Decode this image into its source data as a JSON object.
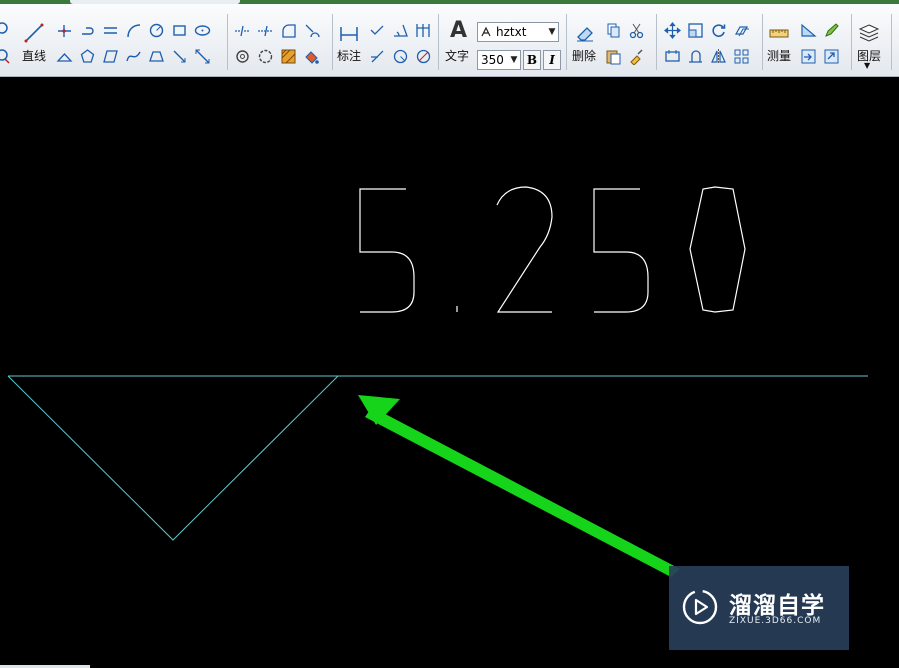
{
  "toolbar": {
    "draw_label": "直线",
    "dim_label": "标注",
    "text_label": "文字",
    "text_big_glyph": "A",
    "font_combo": {
      "value": "hztxt"
    },
    "size_combo": {
      "value": "350"
    },
    "bold_label": "B",
    "italic_label": "I",
    "delete_label": "删除",
    "measure_label": "测量",
    "layer_label": "图层",
    "icon_color": "#1f5fae"
  },
  "drawing": {
    "dimension_text": "5.250",
    "text_color": "#ffffff",
    "line_color": "#5fc8cf",
    "arrow_color": "#16d41a"
  },
  "watermark": {
    "title": "溜溜自学",
    "url": "ZIXUE.3D66.COM"
  }
}
